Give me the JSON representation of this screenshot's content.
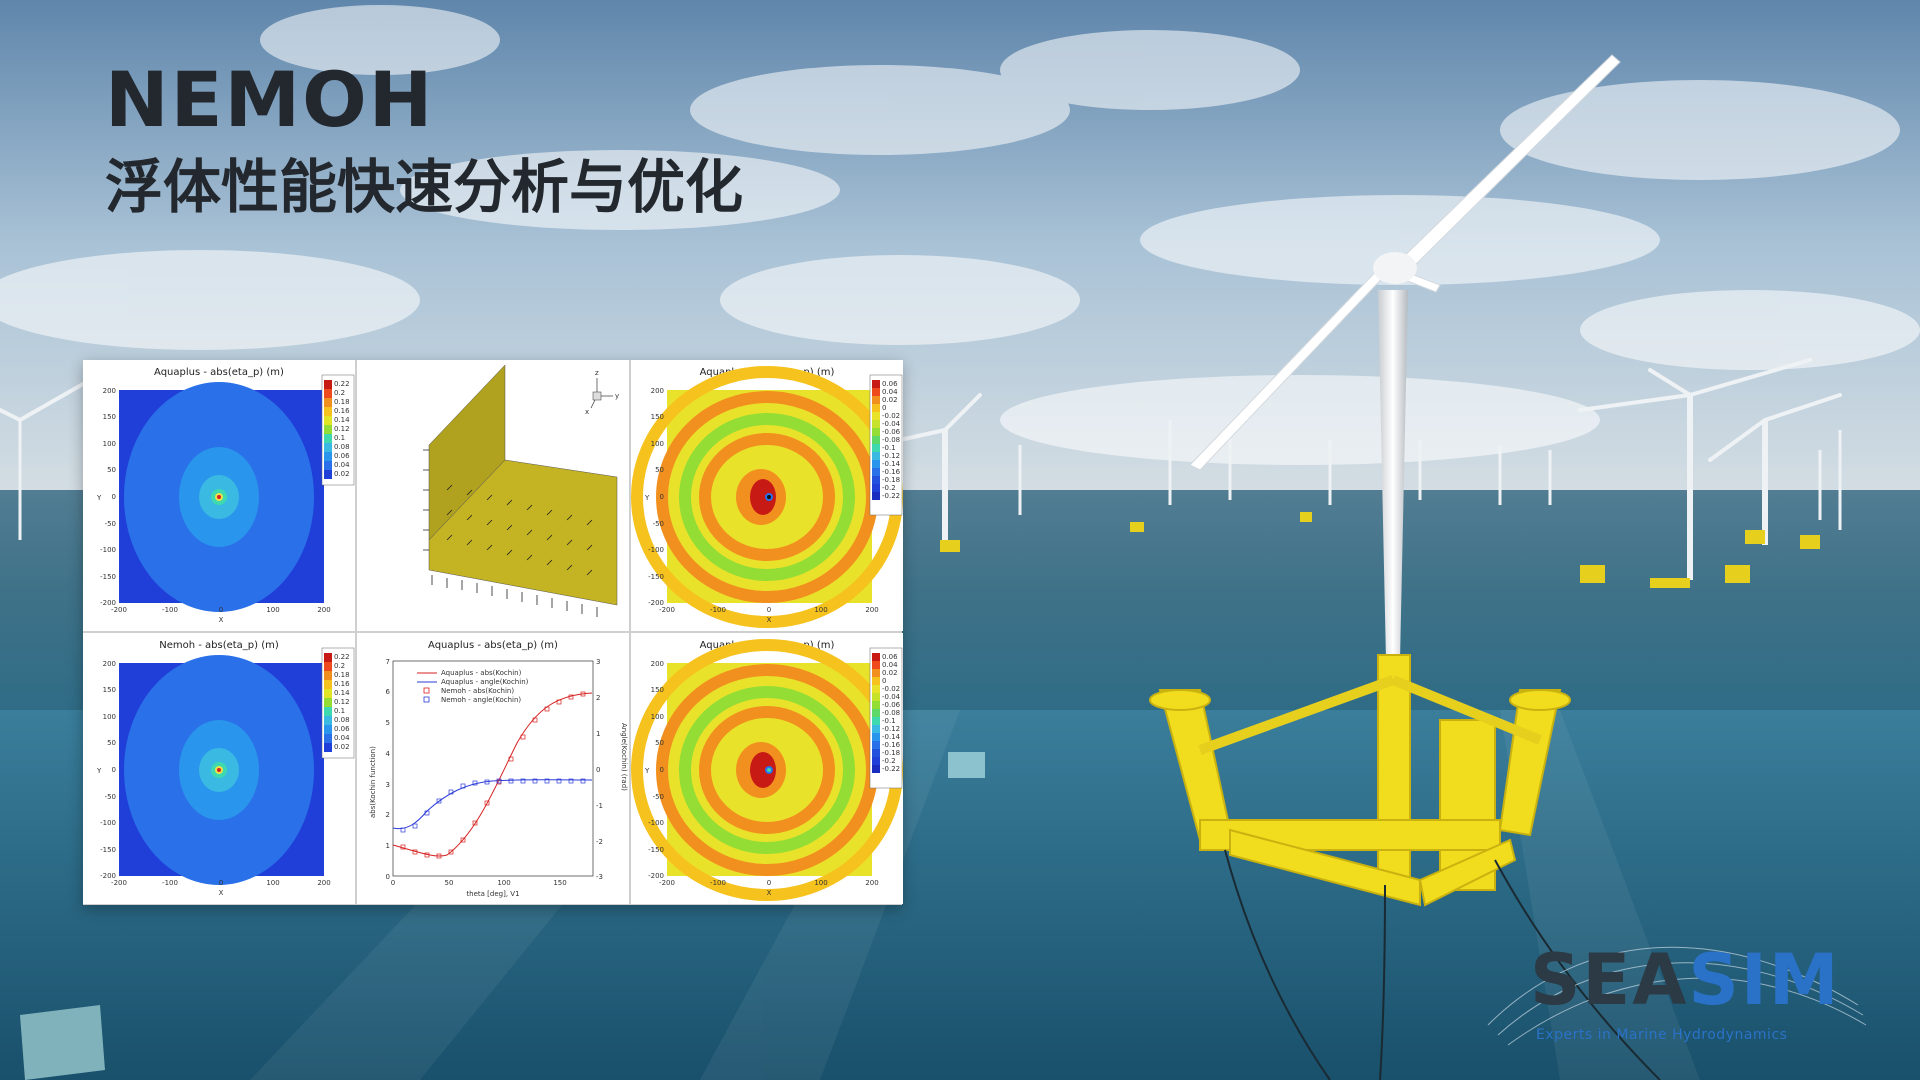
{
  "title": {
    "main": "NEMOH",
    "subtitle": "浮体性能快速分析与优化"
  },
  "panels": [
    {
      "title": "Aquaplus - abs(eta_p) (m)",
      "colorbar": [
        "0.22",
        "0.2",
        "0.18",
        "0.16",
        "0.14",
        "0.12",
        "0.1",
        "0.08",
        "0.06",
        "0.04",
        "0.02"
      ]
    },
    {
      "title": ""
    },
    {
      "title": "Aquaplus - -real(eta_p) (m)",
      "colorbar": [
        "0.06",
        "0.04",
        "0.02",
        "0",
        "-0.02",
        "-0.04",
        "-0.06",
        "-0.08",
        "-0.1",
        "-0.12",
        "-0.14",
        "-0.16",
        "-0.18",
        "-0.2",
        "-0.22"
      ]
    },
    {
      "title": "Nemoh - abs(eta_p) (m)",
      "colorbar": [
        "0.22",
        "0.2",
        "0.18",
        "0.16",
        "0.14",
        "0.12",
        "0.1",
        "0.08",
        "0.06",
        "0.04",
        "0.02"
      ]
    },
    {
      "title": "Aquaplus - abs(eta_p) (m)"
    },
    {
      "title": "Aquaplus - -real(eta_p) (m)",
      "colorbar": [
        "0.06",
        "0.04",
        "0.02",
        "0",
        "-0.02",
        "-0.04",
        "-0.06",
        "-0.08",
        "-0.1",
        "-0.12",
        "-0.14",
        "-0.16",
        "-0.18",
        "-0.2",
        "-0.22"
      ]
    }
  ],
  "axes": {
    "x_label": "X",
    "y_label": "Y",
    "y_ticks": [
      "200",
      "150",
      "100",
      "50",
      "0",
      "-50",
      "-100",
      "-150",
      "-200"
    ],
    "x_ticks": [
      "-200",
      "-100",
      "0",
      "100",
      "200"
    ]
  },
  "kochin_chart": {
    "legend": [
      "Aquaplus - abs(Kochin)",
      "Aquaplus - angle(Kochin)",
      "Nemoh - abs(Kochin)",
      "Nemoh - angle(Kochin)"
    ],
    "xlabel": "theta [deg], V1",
    "ylabel_left": "abs(Kochin function)",
    "ylabel_right": "Angle(Kochin) (rad)",
    "x_ticks": [
      "0",
      "50",
      "100",
      "150"
    ],
    "y_left_ticks": [
      "7",
      "6",
      "5",
      "4",
      "3",
      "2",
      "1",
      "0"
    ],
    "y_right_ticks": [
      "3",
      "2",
      "1",
      "0",
      "-1",
      "-2",
      "-3"
    ]
  },
  "axis3d": {
    "x": "x",
    "y": "y",
    "z": "z"
  },
  "logo": {
    "part1": "SEA",
    "part2": "SIM",
    "tagline": "Experts in Marine Hydrodynamics"
  },
  "colors": {
    "title": "#23282e",
    "logo_dark": "#2b3a44",
    "logo_blue": "#2a72c8",
    "platform": "#f2dc1e"
  }
}
